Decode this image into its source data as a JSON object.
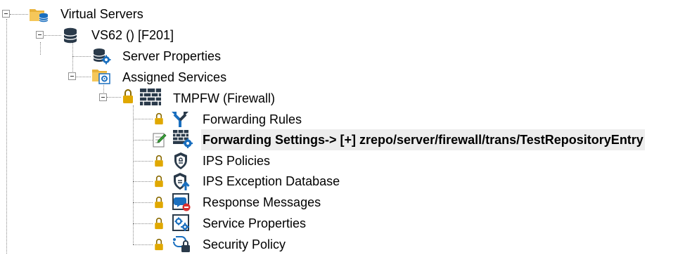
{
  "tree": {
    "root": {
      "label": "Virtual Servers",
      "icon": "folder-database-icon"
    },
    "server": {
      "label": "VS62 () [F201]",
      "icon": "database-icon"
    },
    "server_properties": {
      "label": "Server Properties",
      "icon": "database-gear-icon"
    },
    "assigned_services": {
      "label": "Assigned Services",
      "icon": "folder-gear-icon"
    },
    "firewall": {
      "label": "TMPFW (Firewall)",
      "icon": "firewall-icon",
      "lock_icon": "lock-icon"
    },
    "children": [
      {
        "label": "Forwarding Rules",
        "icon": "forwarding-rules-icon",
        "lock_icon": "lock-icon"
      },
      {
        "label": "Forwarding Settings-> [+] zrepo/server/firewall/trans/TestRepositoryEntry",
        "icon": "firewall-gear-icon",
        "lock_icon": "edit-note-icon",
        "selected": true
      },
      {
        "label": "IPS Policies",
        "icon": "shield-icon",
        "lock_icon": "lock-icon"
      },
      {
        "label": "IPS Exception Database",
        "icon": "shield-upload-icon",
        "lock_icon": "lock-icon"
      },
      {
        "label": "Response Messages",
        "icon": "message-stop-icon",
        "lock_icon": "lock-icon"
      },
      {
        "label": "Service Properties",
        "icon": "service-gear-icon",
        "lock_icon": "lock-icon"
      },
      {
        "label": "Security Policy",
        "icon": "security-policy-icon",
        "lock_icon": "lock-icon"
      }
    ]
  },
  "colors": {
    "folder": "#e8b23a",
    "database": "#2a3a4a",
    "gear_blue": "#1a6fbf",
    "lock": "#e0a800",
    "selection": "#ededed"
  }
}
